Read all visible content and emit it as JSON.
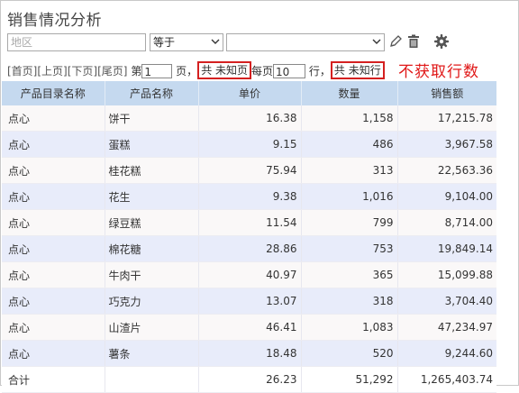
{
  "title": "销售情况分析",
  "filter": {
    "field_placeholder": "地区",
    "operator_value": "等于",
    "value_selected": ""
  },
  "toolbar": {
    "icons": [
      "edit-icon",
      "delete-icon",
      "settings-icon"
    ]
  },
  "pager": {
    "first": "[首页]",
    "prev": "[上页]",
    "next": "[下页]",
    "last": "[尾页]",
    "page_prefix": "第",
    "current_page": "1",
    "page_suffix": "页，",
    "total_pages": "共 未知页",
    "per_page_label": "每页",
    "page_size": "10",
    "row_suffix": "行，",
    "total_rows": "共 未知行"
  },
  "annotation": "不获取行数",
  "accent_colors": {
    "header": "#c5d9ef",
    "even_row": "#e8ecfa",
    "annotation": "#e01818"
  },
  "table": {
    "columns": [
      "产品目录名称",
      "产品名称",
      "单价",
      "数量",
      "销售额"
    ],
    "rows": [
      [
        "点心",
        "饼干",
        "16.38",
        "1,158",
        "17,215.78"
      ],
      [
        "点心",
        "蛋糕",
        "9.15",
        "486",
        "3,967.58"
      ],
      [
        "点心",
        "桂花糕",
        "75.94",
        "313",
        "22,563.36"
      ],
      [
        "点心",
        "花生",
        "9.38",
        "1,016",
        "9,104.00"
      ],
      [
        "点心",
        "绿豆糕",
        "11.54",
        "799",
        "8,714.00"
      ],
      [
        "点心",
        "棉花糖",
        "28.86",
        "753",
        "19,849.14"
      ],
      [
        "点心",
        "牛肉干",
        "40.97",
        "365",
        "15,099.88"
      ],
      [
        "点心",
        "巧克力",
        "13.07",
        "318",
        "3,704.40"
      ],
      [
        "点心",
        "山渣片",
        "46.41",
        "1,083",
        "47,234.97"
      ],
      [
        "点心",
        "薯条",
        "18.48",
        "520",
        "9,244.60"
      ]
    ],
    "total": [
      "合计",
      "",
      "26.23",
      "51,292",
      "1,265,403.74"
    ]
  }
}
